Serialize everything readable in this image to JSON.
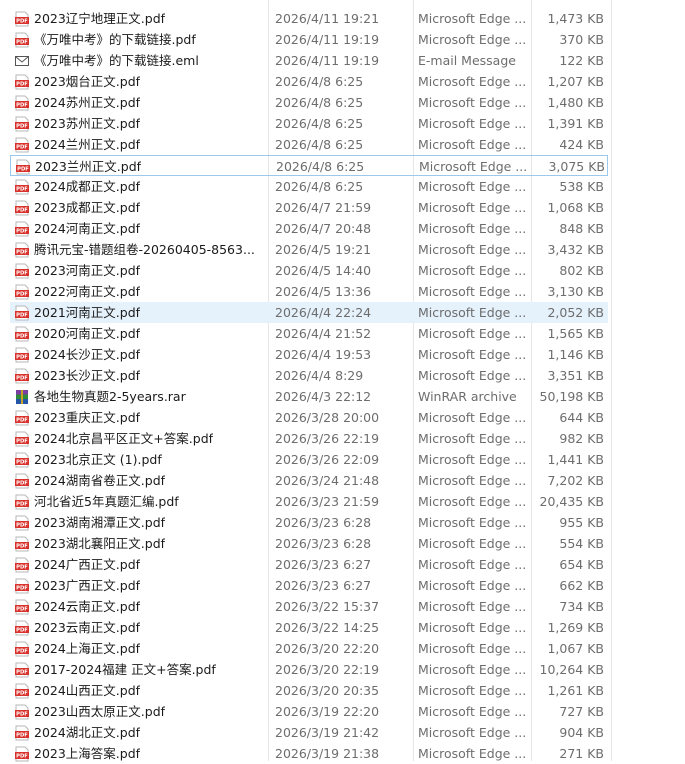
{
  "files": [
    {
      "name": "2023辽宁地理正文.pdf",
      "date": "2026/4/11 19:21",
      "type": "Microsoft Edge ...",
      "size": "1,473 KB",
      "icon": "pdf-icon"
    },
    {
      "name": "《万唯中考》的下载链接.pdf",
      "date": "2026/4/11 19:19",
      "type": "Microsoft Edge ...",
      "size": "370 KB",
      "icon": "pdf-icon"
    },
    {
      "name": "《万唯中考》的下载链接.eml",
      "date": "2026/4/11 19:19",
      "type": "E-mail Message",
      "size": "122 KB",
      "icon": "email-icon"
    },
    {
      "name": "2023烟台正文.pdf",
      "date": "2026/4/8 6:25",
      "type": "Microsoft Edge ...",
      "size": "1,207 KB",
      "icon": "pdf-icon"
    },
    {
      "name": "2024苏州正文.pdf",
      "date": "2026/4/8 6:25",
      "type": "Microsoft Edge ...",
      "size": "1,480 KB",
      "icon": "pdf-icon"
    },
    {
      "name": "2023苏州正文.pdf",
      "date": "2026/4/8 6:25",
      "type": "Microsoft Edge ...",
      "size": "1,391 KB",
      "icon": "pdf-icon"
    },
    {
      "name": "2024兰州正文.pdf",
      "date": "2026/4/8 6:25",
      "type": "Microsoft Edge ...",
      "size": "424 KB",
      "icon": "pdf-icon"
    },
    {
      "name": "2023兰州正文.pdf",
      "date": "2026/4/8 6:25",
      "type": "Microsoft Edge ...",
      "size": "3,075 KB",
      "icon": "pdf-icon"
    },
    {
      "name": "2024成都正文.pdf",
      "date": "2026/4/8 6:25",
      "type": "Microsoft Edge ...",
      "size": "538 KB",
      "icon": "pdf-icon"
    },
    {
      "name": "2023成都正文.pdf",
      "date": "2026/4/7 21:59",
      "type": "Microsoft Edge ...",
      "size": "1,068 KB",
      "icon": "pdf-icon"
    },
    {
      "name": "2024河南正文.pdf",
      "date": "2026/4/7 20:48",
      "type": "Microsoft Edge ...",
      "size": "848 KB",
      "icon": "pdf-icon"
    },
    {
      "name": "腾讯元宝-错题组卷-20260405-8563...",
      "date": "2026/4/5 19:21",
      "type": "Microsoft Edge ...",
      "size": "3,432 KB",
      "icon": "pdf-icon"
    },
    {
      "name": "2023河南正文.pdf",
      "date": "2026/4/5 14:40",
      "type": "Microsoft Edge ...",
      "size": "802 KB",
      "icon": "pdf-icon"
    },
    {
      "name": "2022河南正文.pdf",
      "date": "2026/4/5 13:36",
      "type": "Microsoft Edge ...",
      "size": "3,130 KB",
      "icon": "pdf-icon"
    },
    {
      "name": "2021河南正文.pdf",
      "date": "2026/4/4 22:24",
      "type": "Microsoft Edge ...",
      "size": "2,052 KB",
      "icon": "pdf-icon"
    },
    {
      "name": "2020河南正文.pdf",
      "date": "2026/4/4 21:52",
      "type": "Microsoft Edge ...",
      "size": "1,565 KB",
      "icon": "pdf-icon"
    },
    {
      "name": "2024长沙正文.pdf",
      "date": "2026/4/4 19:53",
      "type": "Microsoft Edge ...",
      "size": "1,146 KB",
      "icon": "pdf-icon"
    },
    {
      "name": "2023长沙正文.pdf",
      "date": "2026/4/4 8:29",
      "type": "Microsoft Edge ...",
      "size": "3,351 KB",
      "icon": "pdf-icon"
    },
    {
      "name": "各地生物真题2-5years.rar",
      "date": "2026/4/3 22:12",
      "type": "WinRAR archive",
      "size": "50,198 KB",
      "icon": "winrar-icon"
    },
    {
      "name": "2023重庆正文.pdf",
      "date": "2026/3/28 20:00",
      "type": "Microsoft Edge ...",
      "size": "644 KB",
      "icon": "pdf-icon"
    },
    {
      "name": "2024北京昌平区正文+答案.pdf",
      "date": "2026/3/26 22:19",
      "type": "Microsoft Edge ...",
      "size": "982 KB",
      "icon": "pdf-icon"
    },
    {
      "name": "2023北京正文 (1).pdf",
      "date": "2026/3/26 22:09",
      "type": "Microsoft Edge ...",
      "size": "1,441 KB",
      "icon": "pdf-icon"
    },
    {
      "name": "2024湖南省卷正文.pdf",
      "date": "2026/3/24 21:48",
      "type": "Microsoft Edge ...",
      "size": "7,202 KB",
      "icon": "pdf-icon"
    },
    {
      "name": "河北省近5年真题汇编.pdf",
      "date": "2026/3/23 21:59",
      "type": "Microsoft Edge ...",
      "size": "20,435 KB",
      "icon": "pdf-icon"
    },
    {
      "name": "2023湖南湘潭正文.pdf",
      "date": "2026/3/23 6:28",
      "type": "Microsoft Edge ...",
      "size": "955 KB",
      "icon": "pdf-icon"
    },
    {
      "name": "2023湖北襄阳正文.pdf",
      "date": "2026/3/23 6:28",
      "type": "Microsoft Edge ...",
      "size": "554 KB",
      "icon": "pdf-icon"
    },
    {
      "name": "2024广西正文.pdf",
      "date": "2026/3/23 6:27",
      "type": "Microsoft Edge ...",
      "size": "654 KB",
      "icon": "pdf-icon"
    },
    {
      "name": "2023广西正文.pdf",
      "date": "2026/3/23 6:27",
      "type": "Microsoft Edge ...",
      "size": "662 KB",
      "icon": "pdf-icon"
    },
    {
      "name": "2024云南正文.pdf",
      "date": "2026/3/22 15:37",
      "type": "Microsoft Edge ...",
      "size": "734 KB",
      "icon": "pdf-icon"
    },
    {
      "name": "2023云南正文.pdf",
      "date": "2026/3/22 14:25",
      "type": "Microsoft Edge ...",
      "size": "1,269 KB",
      "icon": "pdf-icon"
    },
    {
      "name": "2024上海正文.pdf",
      "date": "2026/3/20 22:20",
      "type": "Microsoft Edge ...",
      "size": "1,067 KB",
      "icon": "pdf-icon"
    },
    {
      "name": "2017-2024福建 正文+答案.pdf",
      "date": "2026/3/20 22:19",
      "type": "Microsoft Edge ...",
      "size": "10,264 KB",
      "icon": "pdf-icon"
    },
    {
      "name": "2024山西正文.pdf",
      "date": "2026/3/20 20:35",
      "type": "Microsoft Edge ...",
      "size": "1,261 KB",
      "icon": "pdf-icon"
    },
    {
      "name": "2023山西太原正文.pdf",
      "date": "2026/3/19 22:20",
      "type": "Microsoft Edge ...",
      "size": "727 KB",
      "icon": "pdf-icon"
    },
    {
      "name": "2024湖北正文.pdf",
      "date": "2026/3/19 21:42",
      "type": "Microsoft Edge ...",
      "size": "904 KB",
      "icon": "pdf-icon"
    },
    {
      "name": "2023上海答案.pdf",
      "date": "2026/3/19 21:38",
      "type": "Microsoft Edge ...",
      "size": "271 KB",
      "icon": "pdf-icon"
    }
  ],
  "selected_row": 14,
  "focused_row": 7,
  "colors": {
    "pdf_icon": "#d9312b",
    "selection": "#e5f1fb",
    "focus_border": "#99c9ef"
  }
}
